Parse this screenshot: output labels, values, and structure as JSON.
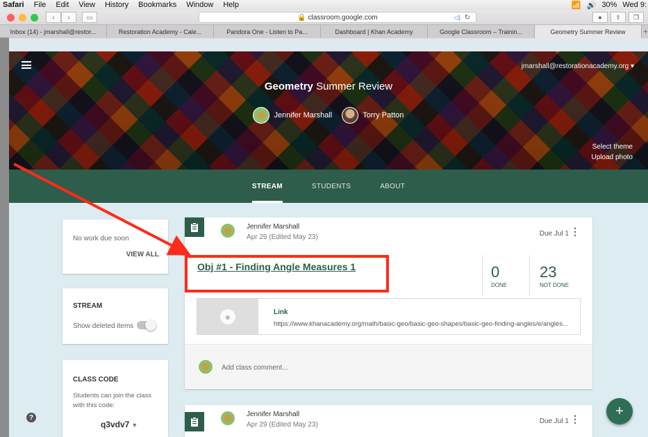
{
  "menubar": {
    "items": [
      "Safari",
      "File",
      "Edit",
      "View",
      "History",
      "Bookmarks",
      "Window",
      "Help"
    ],
    "battery": "30%",
    "clock": "Wed 9:"
  },
  "browser": {
    "url": "classroom.google.com",
    "tabs": [
      "Inbox (14) - jmarshall@restor...",
      "Restoration Academy - Cale...",
      "Pandora One - Listen to Pa...",
      "Dashboard | Khan Academy",
      "Google Classroom – Trainin...",
      "Geometry Summer Review"
    ]
  },
  "banner": {
    "account": "jmarshall@restorationacademy.org",
    "course_bold": "Geometry",
    "course_rest": " Summer Review",
    "teacher1": "Jennifer Marshall",
    "teacher2": "Torry Patton",
    "select_theme": "Select theme",
    "upload_photo": "Upload photo"
  },
  "classnav": {
    "stream": "STREAM",
    "students": "STUDENTS",
    "about": "ABOUT"
  },
  "upcoming": {
    "text": "No work due soon",
    "view_all": "VIEW ALL"
  },
  "stream_settings": {
    "heading": "STREAM",
    "show_deleted": "Show deleted items",
    "toggle_on": false
  },
  "class_code": {
    "heading": "CLASS CODE",
    "subtext": "Students can join the class with this code:",
    "code": "q3vdv7"
  },
  "posts": [
    {
      "author": "Jennifer Marshall",
      "date": "Apr 29 (Edited May 23)",
      "due": "Due Jul 1",
      "title": "Obj #1 - Finding Angle Measures 1",
      "done_count": "0",
      "done_label": "DONE",
      "not_done_count": "23",
      "not_done_label": "NOT DONE",
      "link_label": "Link",
      "link_url": "https://www.khanacademy.org/math/basic-geo/basic-geo-shapes/basic-geo-finding-angles/e/angles...",
      "comment_placeholder": "Add class comment..."
    },
    {
      "author": "Jennifer Marshall",
      "date": "Apr 29 (Edited May 23)",
      "due": "Due Jul 1"
    }
  ],
  "colors": {
    "theme": "#2e5d4b",
    "annotation": "#ff2a1a",
    "background": "#dcecf0"
  },
  "icons": {
    "help": "?",
    "add": "+",
    "more": "⋮",
    "assignment": "clipboard-icon",
    "link": "globe-icon"
  }
}
